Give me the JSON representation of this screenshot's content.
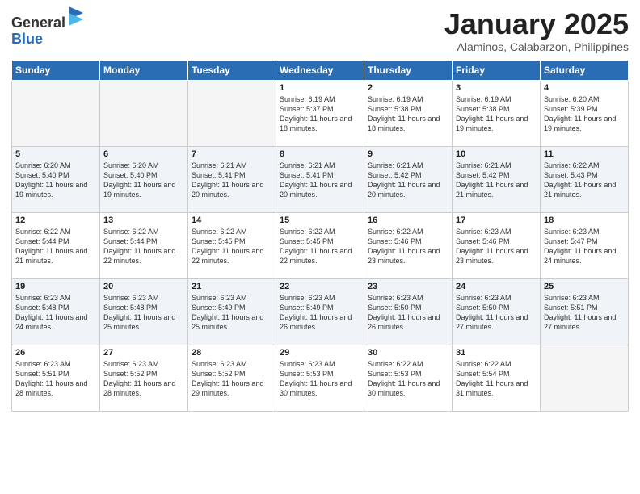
{
  "logo": {
    "general": "General",
    "blue": "Blue"
  },
  "title": "January 2025",
  "location": "Alaminos, Calabarzon, Philippines",
  "days_of_week": [
    "Sunday",
    "Monday",
    "Tuesday",
    "Wednesday",
    "Thursday",
    "Friday",
    "Saturday"
  ],
  "weeks": [
    [
      {
        "day": "",
        "info": ""
      },
      {
        "day": "",
        "info": ""
      },
      {
        "day": "",
        "info": ""
      },
      {
        "day": "1",
        "info": "Sunrise: 6:19 AM\nSunset: 5:37 PM\nDaylight: 11 hours and 18 minutes."
      },
      {
        "day": "2",
        "info": "Sunrise: 6:19 AM\nSunset: 5:38 PM\nDaylight: 11 hours and 18 minutes."
      },
      {
        "day": "3",
        "info": "Sunrise: 6:19 AM\nSunset: 5:38 PM\nDaylight: 11 hours and 19 minutes."
      },
      {
        "day": "4",
        "info": "Sunrise: 6:20 AM\nSunset: 5:39 PM\nDaylight: 11 hours and 19 minutes."
      }
    ],
    [
      {
        "day": "5",
        "info": "Sunrise: 6:20 AM\nSunset: 5:40 PM\nDaylight: 11 hours and 19 minutes."
      },
      {
        "day": "6",
        "info": "Sunrise: 6:20 AM\nSunset: 5:40 PM\nDaylight: 11 hours and 19 minutes."
      },
      {
        "day": "7",
        "info": "Sunrise: 6:21 AM\nSunset: 5:41 PM\nDaylight: 11 hours and 20 minutes."
      },
      {
        "day": "8",
        "info": "Sunrise: 6:21 AM\nSunset: 5:41 PM\nDaylight: 11 hours and 20 minutes."
      },
      {
        "day": "9",
        "info": "Sunrise: 6:21 AM\nSunset: 5:42 PM\nDaylight: 11 hours and 20 minutes."
      },
      {
        "day": "10",
        "info": "Sunrise: 6:21 AM\nSunset: 5:42 PM\nDaylight: 11 hours and 21 minutes."
      },
      {
        "day": "11",
        "info": "Sunrise: 6:22 AM\nSunset: 5:43 PM\nDaylight: 11 hours and 21 minutes."
      }
    ],
    [
      {
        "day": "12",
        "info": "Sunrise: 6:22 AM\nSunset: 5:44 PM\nDaylight: 11 hours and 21 minutes."
      },
      {
        "day": "13",
        "info": "Sunrise: 6:22 AM\nSunset: 5:44 PM\nDaylight: 11 hours and 22 minutes."
      },
      {
        "day": "14",
        "info": "Sunrise: 6:22 AM\nSunset: 5:45 PM\nDaylight: 11 hours and 22 minutes."
      },
      {
        "day": "15",
        "info": "Sunrise: 6:22 AM\nSunset: 5:45 PM\nDaylight: 11 hours and 22 minutes."
      },
      {
        "day": "16",
        "info": "Sunrise: 6:22 AM\nSunset: 5:46 PM\nDaylight: 11 hours and 23 minutes."
      },
      {
        "day": "17",
        "info": "Sunrise: 6:23 AM\nSunset: 5:46 PM\nDaylight: 11 hours and 23 minutes."
      },
      {
        "day": "18",
        "info": "Sunrise: 6:23 AM\nSunset: 5:47 PM\nDaylight: 11 hours and 24 minutes."
      }
    ],
    [
      {
        "day": "19",
        "info": "Sunrise: 6:23 AM\nSunset: 5:48 PM\nDaylight: 11 hours and 24 minutes."
      },
      {
        "day": "20",
        "info": "Sunrise: 6:23 AM\nSunset: 5:48 PM\nDaylight: 11 hours and 25 minutes."
      },
      {
        "day": "21",
        "info": "Sunrise: 6:23 AM\nSunset: 5:49 PM\nDaylight: 11 hours and 25 minutes."
      },
      {
        "day": "22",
        "info": "Sunrise: 6:23 AM\nSunset: 5:49 PM\nDaylight: 11 hours and 26 minutes."
      },
      {
        "day": "23",
        "info": "Sunrise: 6:23 AM\nSunset: 5:50 PM\nDaylight: 11 hours and 26 minutes."
      },
      {
        "day": "24",
        "info": "Sunrise: 6:23 AM\nSunset: 5:50 PM\nDaylight: 11 hours and 27 minutes."
      },
      {
        "day": "25",
        "info": "Sunrise: 6:23 AM\nSunset: 5:51 PM\nDaylight: 11 hours and 27 minutes."
      }
    ],
    [
      {
        "day": "26",
        "info": "Sunrise: 6:23 AM\nSunset: 5:51 PM\nDaylight: 11 hours and 28 minutes."
      },
      {
        "day": "27",
        "info": "Sunrise: 6:23 AM\nSunset: 5:52 PM\nDaylight: 11 hours and 28 minutes."
      },
      {
        "day": "28",
        "info": "Sunrise: 6:23 AM\nSunset: 5:52 PM\nDaylight: 11 hours and 29 minutes."
      },
      {
        "day": "29",
        "info": "Sunrise: 6:23 AM\nSunset: 5:53 PM\nDaylight: 11 hours and 30 minutes."
      },
      {
        "day": "30",
        "info": "Sunrise: 6:22 AM\nSunset: 5:53 PM\nDaylight: 11 hours and 30 minutes."
      },
      {
        "day": "31",
        "info": "Sunrise: 6:22 AM\nSunset: 5:54 PM\nDaylight: 11 hours and 31 minutes."
      },
      {
        "day": "",
        "info": ""
      }
    ]
  ]
}
